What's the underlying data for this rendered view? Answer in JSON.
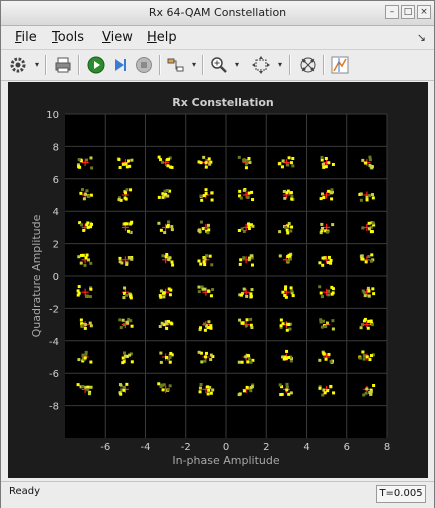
{
  "window": {
    "title": "Rx 64-QAM Constellation"
  },
  "menubar": {
    "items": [
      {
        "id": "file",
        "label": "File",
        "mnemonic": "F",
        "rest": "ile"
      },
      {
        "id": "tools",
        "label": "Tools",
        "mnemonic": "T",
        "rest": "ools"
      },
      {
        "id": "view",
        "label": "View",
        "mnemonic": "V",
        "rest": "iew"
      },
      {
        "id": "help",
        "label": "Help",
        "mnemonic": "H",
        "rest": "elp"
      }
    ]
  },
  "toolbar": {
    "icons": [
      "settings-icon",
      "print-icon",
      "run-icon",
      "step-forward-icon",
      "stop-icon",
      "signal-selector-icon",
      "zoom-in-icon",
      "fit-to-view-icon",
      "constellation-icon",
      "data-cursor-icon"
    ]
  },
  "status": {
    "left": "Ready",
    "right": "T=0.005"
  },
  "colors": {
    "background": "#1c1c1c",
    "axes": "#000000",
    "grid": "#3a3a3a",
    "ticks": "#cfcfcf",
    "reference": "#ff2020",
    "points_primary": "#ffff00",
    "points_secondary": "#c8d040",
    "points_tertiary": "#6a7a20"
  },
  "chart_data": {
    "type": "scatter",
    "title": "Rx Constellation",
    "xlabel": "In-phase Amplitude",
    "ylabel": "Quadrature Amplitude",
    "xlim": [
      -8,
      8
    ],
    "ylim": [
      -10,
      10
    ],
    "xticks": [
      -6,
      -4,
      -2,
      0,
      2,
      4,
      6,
      8
    ],
    "yticks": [
      -8,
      -6,
      -4,
      -2,
      0,
      2,
      4,
      6,
      8,
      10
    ],
    "grid": true,
    "reference_levels": [
      -7,
      -5,
      -3,
      -1,
      1,
      3,
      5,
      7
    ],
    "reference_marker": "+",
    "received_symbol_spread": 0.35
  }
}
